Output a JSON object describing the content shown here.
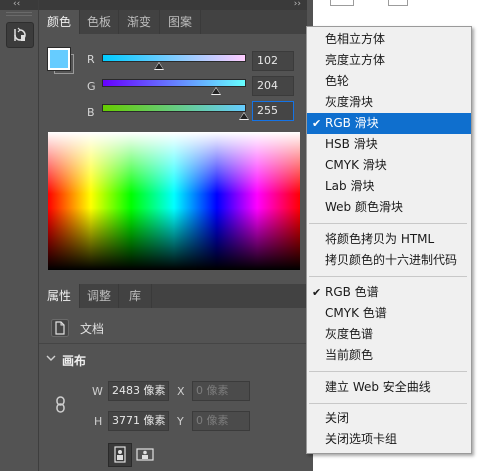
{
  "tools": {
    "collapse_glyph": "‹‹",
    "history_icon": "history-brush-icon"
  },
  "panel": {
    "collapse_glyph": "››",
    "tabs": [
      {
        "label": "颜色",
        "active": true
      },
      {
        "label": "色板",
        "active": false
      },
      {
        "label": "渐变",
        "active": false
      },
      {
        "label": "图案",
        "active": false
      }
    ],
    "menu_icon": "panel-menu-icon",
    "color": {
      "swatch_hex": "#66CCFF",
      "sliders": [
        {
          "label": "R",
          "value": "102"
        },
        {
          "label": "G",
          "value": "204"
        },
        {
          "label": "B",
          "value": "255"
        }
      ],
      "focused_channel": "B"
    }
  },
  "properties": {
    "tabs": [
      {
        "label": "属性",
        "active": true
      },
      {
        "label": "调整",
        "active": false
      },
      {
        "label": "库",
        "active": false
      }
    ],
    "doc_label": "文档",
    "canvas_title": "画布",
    "fields": {
      "w_label": "W",
      "w_value": "2483 像素",
      "x_label": "X",
      "x_value": "0 像素",
      "h_label": "H",
      "h_value": "3771 像素",
      "y_label": "Y",
      "y_value": "0 像素"
    }
  },
  "menu": {
    "items": [
      {
        "label": "色相立方体",
        "checked": false,
        "selected": false
      },
      {
        "label": "亮度立方体",
        "checked": false,
        "selected": false
      },
      {
        "label": "色轮",
        "checked": false,
        "selected": false
      },
      {
        "label": "灰度滑块",
        "checked": false,
        "selected": false
      },
      {
        "label": "RGB 滑块",
        "checked": true,
        "selected": true
      },
      {
        "label": "HSB 滑块",
        "checked": false,
        "selected": false
      },
      {
        "label": "CMYK 滑块",
        "checked": false,
        "selected": false
      },
      {
        "label": "Lab 滑块",
        "checked": false,
        "selected": false
      },
      {
        "label": "Web 颜色滑块",
        "checked": false,
        "selected": false
      },
      {
        "label": "将颜色拷贝为 HTML",
        "checked": false,
        "selected": false
      },
      {
        "label": "拷贝颜色的十六进制代码",
        "checked": false,
        "selected": false
      },
      {
        "label": "RGB 色谱",
        "checked": true,
        "selected": false
      },
      {
        "label": "CMYK 色谱",
        "checked": false,
        "selected": false
      },
      {
        "label": "灰度色谱",
        "checked": false,
        "selected": false
      },
      {
        "label": "当前颜色",
        "checked": false,
        "selected": false
      },
      {
        "label": "建立 Web 安全曲线",
        "checked": false,
        "selected": false
      },
      {
        "label": "关闭",
        "checked": false,
        "selected": false
      },
      {
        "label": "关闭选项卡组",
        "checked": false,
        "selected": false
      }
    ],
    "check_glyph": "✔"
  },
  "colors": {
    "accent": "#0F6FCE",
    "panel_bg": "#535353",
    "focus_border": "#1473E6"
  }
}
